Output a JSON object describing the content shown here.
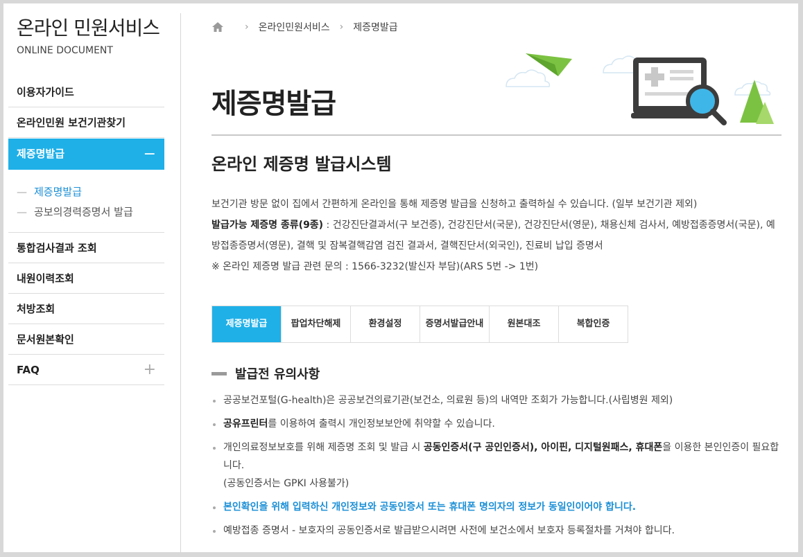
{
  "sidebar": {
    "title": "온라인 민원서비스",
    "subtitle": "ONLINE DOCUMENT",
    "menu": [
      {
        "label": "이용자가이드"
      },
      {
        "label": "온라인민원 보건기관찾기"
      },
      {
        "label": "제증명발급",
        "sign": "−"
      },
      {
        "label": "통합검사결과 조회"
      },
      {
        "label": "내원이력조회"
      },
      {
        "label": "처방조회"
      },
      {
        "label": "문서원본확인"
      },
      {
        "label": "FAQ",
        "sign": "+"
      }
    ],
    "submenu": [
      {
        "label": "제증명발급"
      },
      {
        "label": "공보의경력증명서 발급"
      }
    ]
  },
  "breadcrumb": {
    "home_icon": "home-icon",
    "items": [
      "온라인민원서비스",
      "제증명발급"
    ]
  },
  "page": {
    "title": "제증명발급",
    "section_title": "온라인 제증명 발급시스템",
    "intro_line1": "보건기관 방문 없이 집에서 간편하게 온라인을 통해 제증명 발급을 신청하고 출력하실 수 있습니다. (일부 보건기관 제외)",
    "intro_label": "발급가능 제증명 종류(9종)",
    "intro_kinds": " : 건강진단결과서(구 보건증), 건강진단서(국문), 건강진단서(영문), 채용신체 검사서, 예방접종증명서(국문), 예방접종증명서(영문), 결핵 및 잠복결핵감염 검진 결과서, 결핵진단서(외국인), 진료비 납입 증명서",
    "intro_contact": "※ 온라인 제증명 발급 관련 문의 : 1566-3232(발신자 부담)(ARS 5번 -> 1번)"
  },
  "tabs": [
    "제증명발급",
    "팝업차단해제",
    "환경설정",
    "증명서발급안내",
    "원본대조",
    "복합인증"
  ],
  "notice": {
    "title": "발급전 유의사항",
    "b1": "공공보건포털(G-health)은 공공보건의료기관(보건소, 의료원 등)의 내역만 조회가 가능합니다.(사립병원 제외)",
    "b2_bold": "공유프린터",
    "b2_rest": "를 이용하여 출력시 개인정보보안에 취약할 수 있습니다.",
    "b3_pre": "개인의료정보보호를 위해 제증명 조회 및 발급 시 ",
    "b3_bold1": "공동인증서(구 공인인증서), 아이핀, 디지털원패스, 휴대폰",
    "b3_post": "을 이용한 본인인증이 필요합니다.",
    "b3_note": "(공동인증서는 GPKI 사용불가)",
    "b4": "본인확인을 위해 입력하신 개인정보와 공동인증서 또는 휴대폰 명의자의 정보가 동일인이어야 합니다.",
    "b5": "예방접종 증명서 - 보호자의 공동인증서로 발급받으시려면 사전에 보건소에서 보호자 등록절차를 거쳐야 합니다."
  },
  "colors": {
    "accent": "#1fb0e8",
    "link": "#1b8fd6"
  },
  "hero_icons": [
    "paper-plane-icon",
    "monitor-document-icon",
    "magnifier-icon",
    "tree-icon",
    "cloud-icon"
  ]
}
